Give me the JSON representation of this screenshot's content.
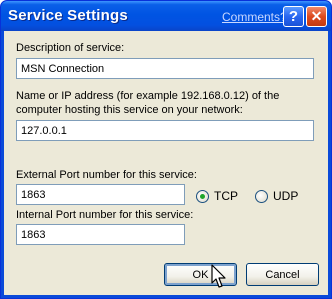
{
  "window": {
    "title": "Service Settings",
    "comments_link": "Comments?",
    "help_button": "?",
    "close_button": "✕"
  },
  "form": {
    "description_label": "Description of service:",
    "description_value": "MSN Connection",
    "address_label_line1": "Name or IP address (for example 192.168.0.12) of the",
    "address_label_line2": "computer hosting this service on your network:",
    "address_value": "127.0.0.1",
    "external_port_label": "External Port number for this service:",
    "external_port_value": "1863",
    "internal_port_label": "Internal Port number for this service:",
    "internal_port_value": "1863",
    "protocol": {
      "options": [
        "TCP",
        "UDP"
      ],
      "selected": "TCP"
    }
  },
  "buttons": {
    "ok": "OK",
    "cancel": "Cancel"
  },
  "colors": {
    "titlebar": "#0054e3",
    "dialog_bg": "#ece9d8",
    "radio_selected": "#1fa52a"
  }
}
